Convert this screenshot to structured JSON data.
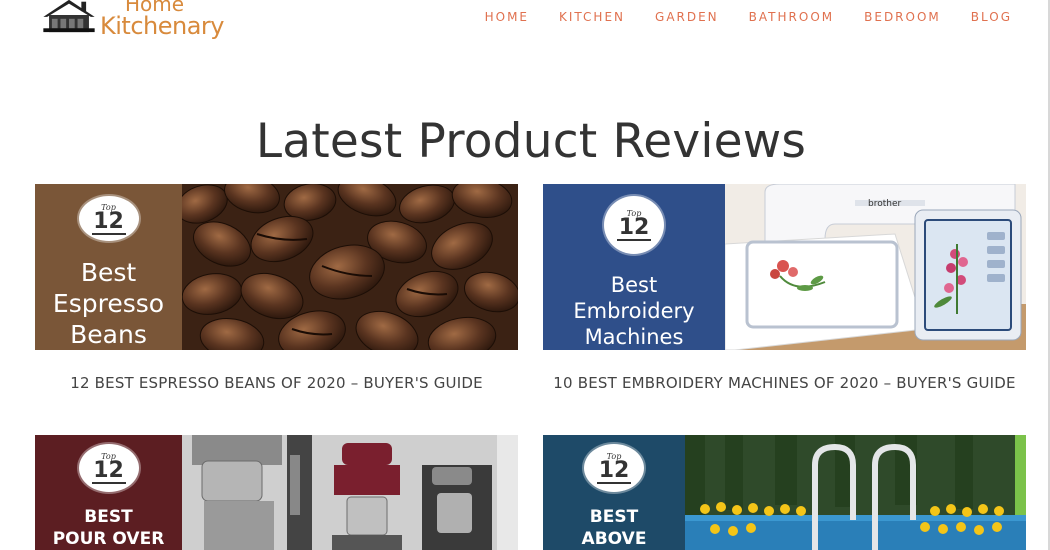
{
  "header": {
    "logo_top": "Home",
    "logo_bottom": "Kitchenary",
    "nav": [
      "HOME",
      "KITCHEN",
      "GARDEN",
      "BATHROOM",
      "BEDROOM",
      "BLOG"
    ]
  },
  "main": {
    "title": "Latest Product Reviews",
    "cards": [
      {
        "badge_top": "Top",
        "badge_num": "12",
        "panel_lines": [
          "Best",
          "Espresso",
          "Beans"
        ],
        "title": "12 BEST ESPRESSO BEANS OF 2020 – BUYER'S GUIDE",
        "panel_color": "#7a5638"
      },
      {
        "badge_top": "Top",
        "badge_num": "12",
        "panel_lines": [
          "Best",
          "Embroidery",
          "Machines"
        ],
        "photo_brand": "brother",
        "title": "10 BEST EMBROIDERY MACHINES OF 2020 – BUYER'S GUIDE",
        "panel_color": "#2f4f8a"
      },
      {
        "badge_top": "Top",
        "badge_num": "12",
        "panel_lines": [
          "BEST",
          "POUR OVER"
        ],
        "panel_color": "#5c1e22"
      },
      {
        "badge_top": "Top",
        "badge_num": "12",
        "panel_lines": [
          "BEST",
          "ABOVE"
        ],
        "panel_color": "#1e4a68"
      }
    ]
  },
  "colors": {
    "nav": "#e0714f",
    "logo": "#d88a3c",
    "title": "#333333"
  }
}
